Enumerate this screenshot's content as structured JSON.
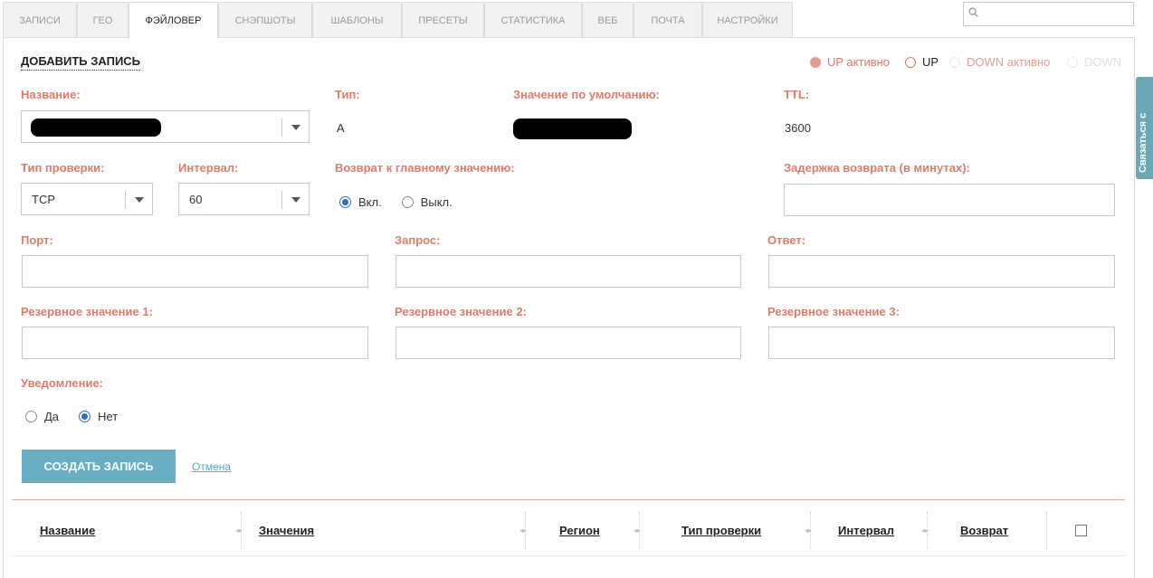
{
  "tabs": [
    {
      "label": "ЗАПИСИ"
    },
    {
      "label": "ГЕО"
    },
    {
      "label": "ФЭЙЛОВЕР"
    },
    {
      "label": "СНЭПШОТЫ"
    },
    {
      "label": "ШАБЛОНЫ"
    },
    {
      "label": "ПРЕСЕТЫ"
    },
    {
      "label": "СТАТИСТИКА"
    },
    {
      "label": "ВЕБ"
    },
    {
      "label": "ПОЧТА"
    },
    {
      "label": "НАСТРОЙКИ"
    }
  ],
  "search": {
    "placeholder": ""
  },
  "side_tab": {
    "label": "Связаться с"
  },
  "form": {
    "title": "ДОБАВИТЬ ЗАПИСЬ",
    "legend": {
      "up_active": "UP активно",
      "up": "UP",
      "down_active": "DOWN активно",
      "down": "DOWN"
    },
    "name_label": "Название:",
    "type_label": "Тип:",
    "type_value": "A",
    "default_label": "Значение по умолчанию:",
    "ttl_label": "TTL:",
    "ttl_value": "3600",
    "check_type_label": "Тип проверки:",
    "check_type_value": "TCP",
    "interval_label": "Интервал:",
    "interval_value": "60",
    "return_label": "Возврат к главному значению:",
    "return_on": "Вкл.",
    "return_off": "Выкл.",
    "delay_label": "Задержка возврата (в минутах):",
    "port_label": "Порт:",
    "request_label": "Запрос:",
    "answer_label": "Ответ:",
    "backup1_label": "Резервное значение 1:",
    "backup2_label": "Резервное значение 2:",
    "backup3_label": "Резервное значение 3:",
    "notify_label": "Уведомление:",
    "notify_yes": "Да",
    "notify_no": "Нет",
    "create_button": "СОЗДАТЬ ЗАПИСЬ",
    "cancel_link": "Отмена"
  },
  "table": {
    "headers": [
      "Название",
      "Значения",
      "Регион",
      "Тип проверки",
      "Интервал",
      "Возврат"
    ]
  },
  "colors": {
    "accent_label": "#e07a6a",
    "button": "#6aaec4",
    "radio_on": "#2a6fb8",
    "side_tab": "#6ba8b7"
  }
}
